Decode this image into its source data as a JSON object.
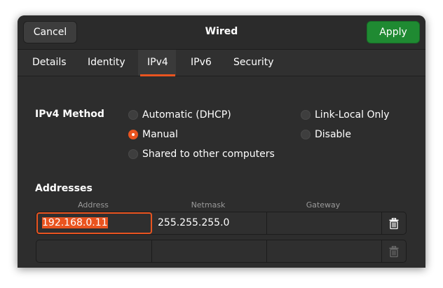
{
  "header": {
    "title": "Wired",
    "cancel_label": "Cancel",
    "apply_label": "Apply"
  },
  "tabs": [
    {
      "label": "Details"
    },
    {
      "label": "Identity"
    },
    {
      "label": "IPv4"
    },
    {
      "label": "IPv6"
    },
    {
      "label": "Security"
    }
  ],
  "ipv4": {
    "method_label": "IPv4 Method",
    "methods": [
      {
        "label": "Automatic (DHCP)",
        "checked": false
      },
      {
        "label": "Link-Local Only",
        "checked": false
      },
      {
        "label": "Manual",
        "checked": true
      },
      {
        "label": "Disable",
        "checked": false
      },
      {
        "label": "Shared to other computers",
        "checked": false
      }
    ]
  },
  "addresses": {
    "section_label": "Addresses",
    "columns": [
      "Address",
      "Netmask",
      "Gateway"
    ],
    "rows": [
      {
        "address": "192.168.0.11",
        "netmask": "255.255.255.0",
        "gateway": ""
      },
      {
        "address": "",
        "netmask": "",
        "gateway": ""
      }
    ]
  },
  "colors": {
    "accent": "#e95420",
    "apply": "#1f8a32",
    "background": "#2d2d2d"
  },
  "icons": {
    "delete": "trash-icon"
  }
}
